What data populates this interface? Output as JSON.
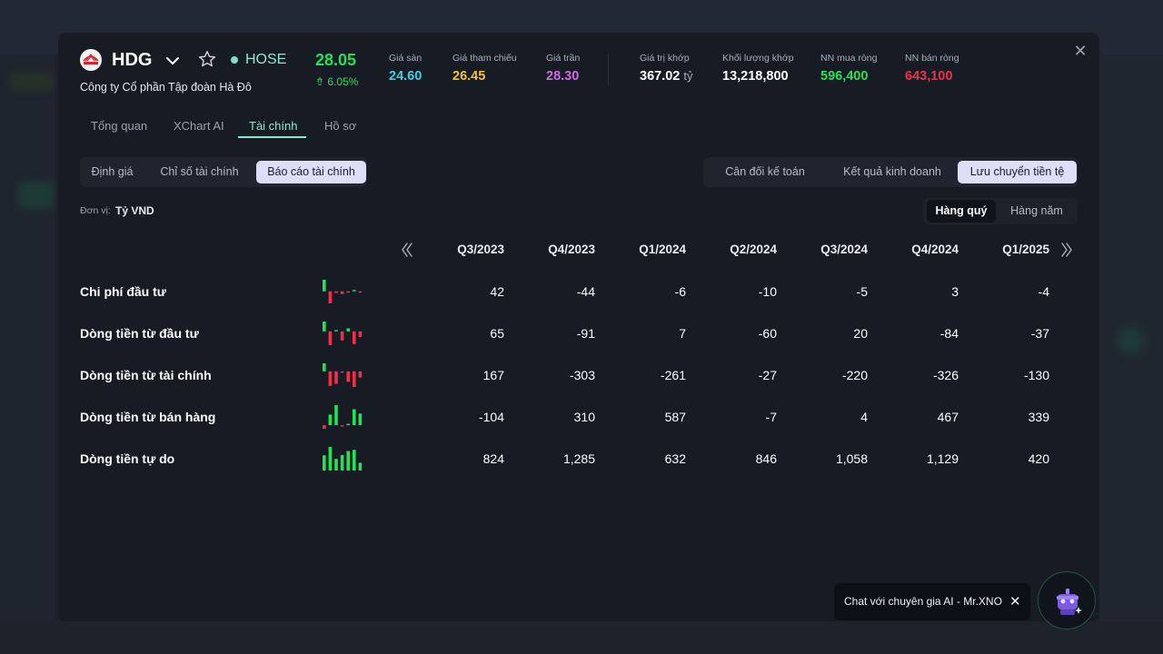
{
  "header": {
    "ticker": "HDG",
    "exchange": "HOSE",
    "company_name": "Công ty Cổ phần Tập đoàn Hà Đô",
    "price": "28.05",
    "change": "6.05%",
    "stats": [
      {
        "label": "Giá sàn",
        "value": "24.60",
        "color": "#3fd0e6"
      },
      {
        "label": "Giá tham chiếu",
        "value": "26.45",
        "color": "#f2c230"
      },
      {
        "label": "Giá trần",
        "value": "28.30",
        "color": "#d36ae0"
      },
      {
        "label": "Giá trị khớp",
        "value": "367.02",
        "unit": "tỷ",
        "color": "#ffffff"
      },
      {
        "label": "Khối lượng khớp",
        "value": "13,218,800",
        "color": "#ffffff"
      },
      {
        "label": "NN mua ròng",
        "value": "596,400",
        "color": "#27e05a"
      },
      {
        "label": "NN bán ròng",
        "value": "643,100",
        "color": "#f0304a"
      }
    ]
  },
  "main_tabs": [
    "Tổng quan",
    "XChart AI",
    "Tài chính",
    "Hồ sơ"
  ],
  "sub_tabs": [
    "Định giá",
    "Chỉ số tài chính",
    "Báo cáo tài chính"
  ],
  "report_tabs": [
    "Cân đối kế toán",
    "Kết quả kinh doanh",
    "Lưu chuyển tiền tệ"
  ],
  "unit": {
    "label": "Đơn vị:",
    "value": "Tỷ VND"
  },
  "period_tabs": [
    "Hàng quý",
    "Hàng năm"
  ],
  "table": {
    "columns": [
      "Q3/2023",
      "Q4/2023",
      "Q1/2024",
      "Q2/2024",
      "Q3/2024",
      "Q4/2024",
      "Q1/2025"
    ],
    "rows": [
      {
        "label": "Chi phí đầu tư",
        "values": [
          42,
          -44,
          -6,
          -10,
          -5,
          3,
          -4
        ],
        "display": [
          "42",
          "-44",
          "-6",
          "-10",
          "-5",
          "3",
          "-4"
        ]
      },
      {
        "label": "Dòng tiền từ đầu tư",
        "values": [
          65,
          -91,
          7,
          -60,
          20,
          -84,
          -37
        ],
        "display": [
          "65",
          "-91",
          "7",
          "-60",
          "20",
          "-84",
          "-37"
        ]
      },
      {
        "label": "Dòng tiền từ tài chính",
        "values": [
          167,
          -303,
          -261,
          -27,
          -220,
          -326,
          -130
        ],
        "display": [
          "167",
          "-303",
          "-261",
          "-27",
          "-220",
          "-326",
          "-130"
        ]
      },
      {
        "label": "Dòng tiền từ bán hàng",
        "values": [
          -104,
          310,
          587,
          -7,
          4,
          467,
          339
        ],
        "display": [
          "-104",
          "310",
          "587",
          "-7",
          "4",
          "467",
          "339"
        ]
      },
      {
        "label": "Dòng tiền tự do",
        "values": [
          824,
          1285,
          632,
          846,
          1058,
          1129,
          420
        ],
        "display": [
          "824",
          "1,285",
          "632",
          "846",
          "1,058",
          "1,129",
          "420"
        ]
      }
    ]
  },
  "colors": {
    "positive": "#27e05a",
    "negative": "#f0304a",
    "accent": "#8fe6cf"
  },
  "chat": {
    "text": "Chat với chuyên gia AI - Mr.XNO"
  }
}
